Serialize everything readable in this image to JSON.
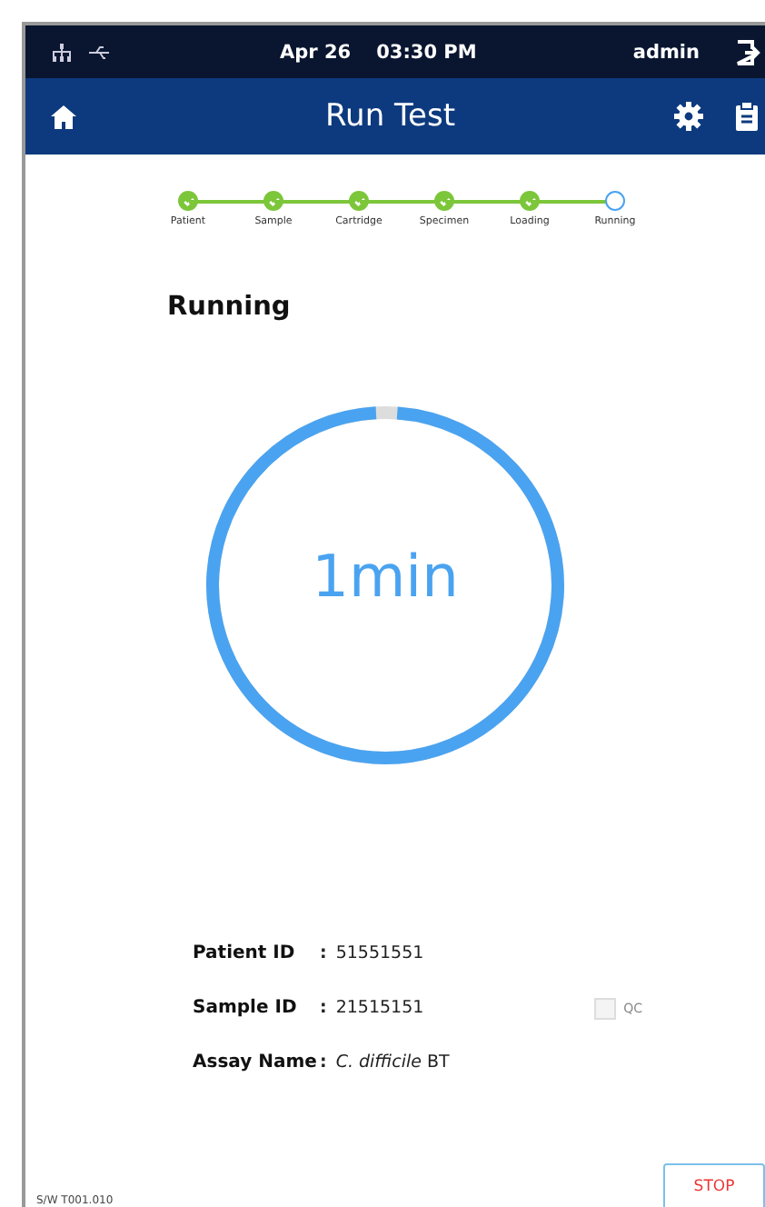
{
  "status_bar": {
    "date": "Apr 26",
    "time": "03:30 PM",
    "user": "admin"
  },
  "header": {
    "title": "Run Test"
  },
  "steps": [
    {
      "label": "Patient",
      "done": true
    },
    {
      "label": "Sample",
      "done": true
    },
    {
      "label": "Cartridge",
      "done": true
    },
    {
      "label": "Specimen",
      "done": true
    },
    {
      "label": "Loading",
      "done": true
    },
    {
      "label": "Running",
      "done": false
    }
  ],
  "section_title": "Running",
  "progress": {
    "level": 0.98,
    "text": "1min"
  },
  "info": [
    {
      "label": "Patient ID",
      "separator": ":",
      "value": "51551551"
    },
    {
      "label": "Sample ID",
      "separator": ":",
      "value": "21515151"
    },
    {
      "label": "Assay Name",
      "separator": ":",
      "value": "*C. difficile* BT"
    }
  ],
  "qc": {
    "label": "QC",
    "checked": false
  },
  "stop_button": "STOP",
  "version": "S/W T001.010"
}
